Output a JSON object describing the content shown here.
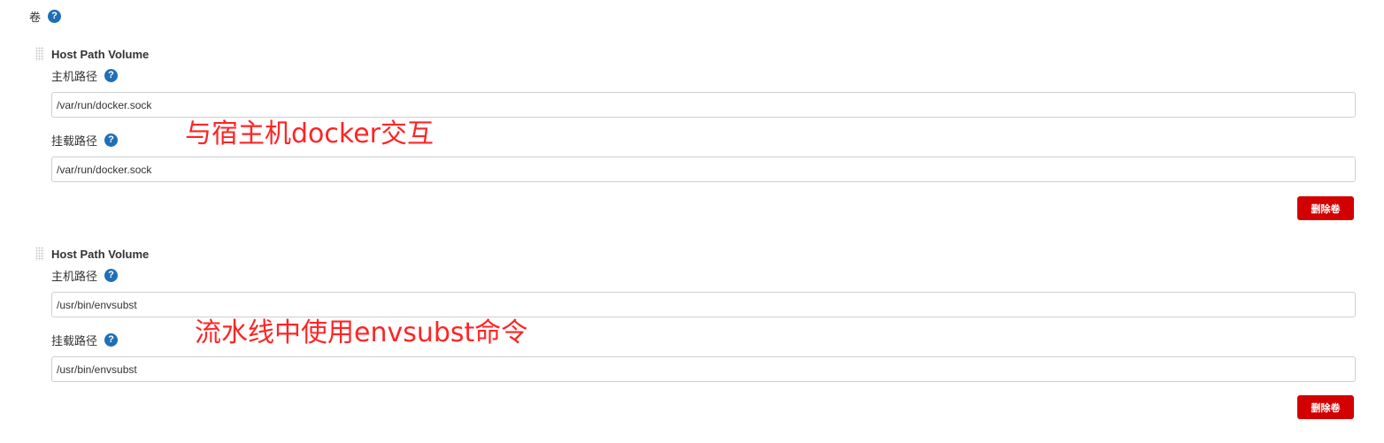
{
  "section": {
    "title": "卷",
    "help_icon": "?"
  },
  "volumes": [
    {
      "title": "Host Path Volume",
      "host_path_label": "主机路径",
      "host_path_value": "/var/run/docker.sock",
      "mount_path_label": "挂载路径",
      "mount_path_value": "/var/run/docker.sock",
      "delete_label": "删除卷",
      "annotation": "与宿主机docker交互"
    },
    {
      "title": "Host Path Volume",
      "host_path_label": "主机路径",
      "host_path_value": "/usr/bin/envsubst",
      "mount_path_label": "挂载路径",
      "mount_path_value": "/usr/bin/envsubst",
      "delete_label": "删除卷",
      "annotation": "流水线中使用envsubst命令"
    }
  ],
  "colors": {
    "help_icon": "#1f6fb6",
    "delete_button": "#d20000",
    "annotation": "#ff2424"
  }
}
